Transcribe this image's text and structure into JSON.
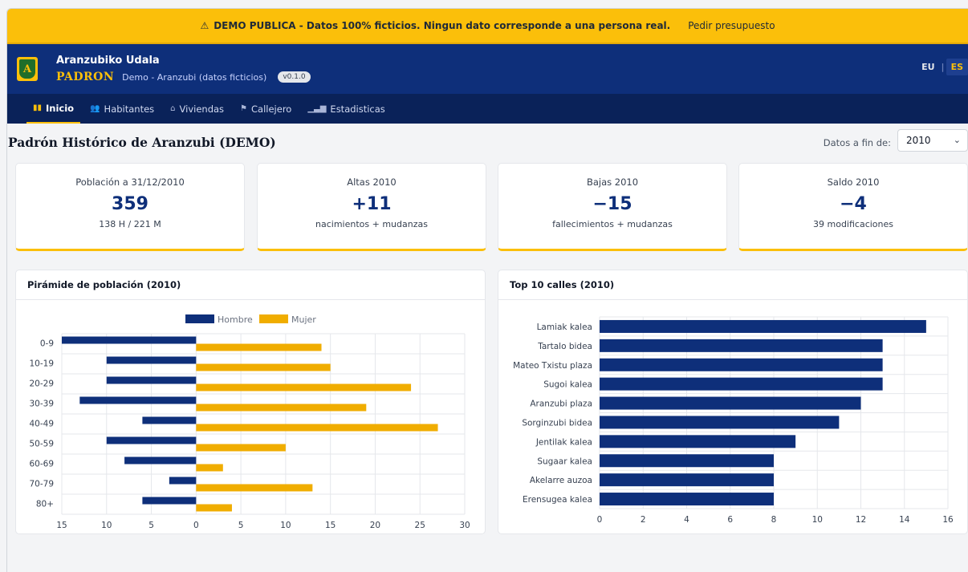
{
  "banner": {
    "icon": "warning-icon",
    "message": "DEMO PUBLICA - Datos 100% ficticios. Ningun dato corresponde a una persona real.",
    "cta": "Pedir presupuesto",
    "color": "#fbbf0a"
  },
  "header": {
    "crest_letter": "A",
    "org_name": "Aranzubiko Udala",
    "app_name": "PADRON",
    "subtitle": "Demo - Aranzubi (datos ficticios)",
    "version": "v0.1.0",
    "lang_eu": "EU",
    "lang_sep": "|",
    "lang_es": "ES",
    "color": "#0e2f7a"
  },
  "nav": {
    "items": [
      {
        "label": "Inicio",
        "icon": "home-icon",
        "active": true
      },
      {
        "label": "Habitantes",
        "icon": "people-icon",
        "active": false
      },
      {
        "label": "Viviendas",
        "icon": "house-icon",
        "active": false
      },
      {
        "label": "Callejero",
        "icon": "signpost-icon",
        "active": false
      },
      {
        "label": "Estadisticas",
        "icon": "bar-chart-icon",
        "active": false
      }
    ]
  },
  "page": {
    "title": "Padrón Histórico de Aranzubi (DEMO)",
    "year_label": "Datos a fin de:",
    "year_value": "2010"
  },
  "kpis": [
    {
      "label": "Población a 31/12/2010",
      "value": "359",
      "note": "138 H / 221 M"
    },
    {
      "label": "Altas 2010",
      "value": "+11",
      "note": "nacimientos + mudanzas"
    },
    {
      "label": "Bajas 2010",
      "value": "−15",
      "note": "fallecimientos + mudanzas"
    },
    {
      "label": "Saldo 2010",
      "value": "−4",
      "note": "39 modificaciones"
    }
  ],
  "panels": {
    "pyramid_title": "Pirámide de población (2010)",
    "streets_title": "Top 10 calles (2010)"
  },
  "chart_data": [
    {
      "type": "bar",
      "orientation": "horizontal",
      "title": "Pirámide de población (2010)",
      "categories": [
        "0-9",
        "10-19",
        "20-29",
        "30-39",
        "40-49",
        "50-59",
        "60-69",
        "70-79",
        "80+"
      ],
      "series": [
        {
          "name": "Hombre",
          "values": [
            15,
            10,
            10,
            13,
            6,
            10,
            8,
            3,
            6
          ],
          "color": "#0e2f7a"
        },
        {
          "name": "Mujer",
          "values": [
            14,
            15,
            24,
            19,
            27,
            10,
            3,
            13,
            4
          ],
          "color": "#f0ad00"
        }
      ],
      "xlim": [
        -15,
        30
      ],
      "xticks": [
        -15,
        -10,
        -5,
        0,
        5,
        10,
        15,
        20,
        25,
        30
      ],
      "xtick_labels": [
        "15",
        "10",
        "5",
        "0",
        "5",
        "10",
        "15",
        "20",
        "25",
        "30"
      ],
      "grid": true,
      "legend": "top-center"
    },
    {
      "type": "bar",
      "orientation": "horizontal",
      "title": "Top 10 calles (2010)",
      "categories": [
        "Lamiak kalea",
        "Tartalo bidea",
        "Mateo Txistu plaza",
        "Sugoi kalea",
        "Aranzubi plaza",
        "Sorginzubi bidea",
        "Jentilak kalea",
        "Sugaar kalea",
        "Akelarre auzoa",
        "Erensugea kalea"
      ],
      "values": [
        15,
        13,
        13,
        13,
        12,
        11,
        9,
        8,
        8,
        8
      ],
      "color": "#0e2f7a",
      "xlim": [
        0,
        16
      ],
      "xticks": [
        0,
        2,
        4,
        6,
        8,
        10,
        12,
        14,
        16
      ],
      "grid": true
    }
  ]
}
